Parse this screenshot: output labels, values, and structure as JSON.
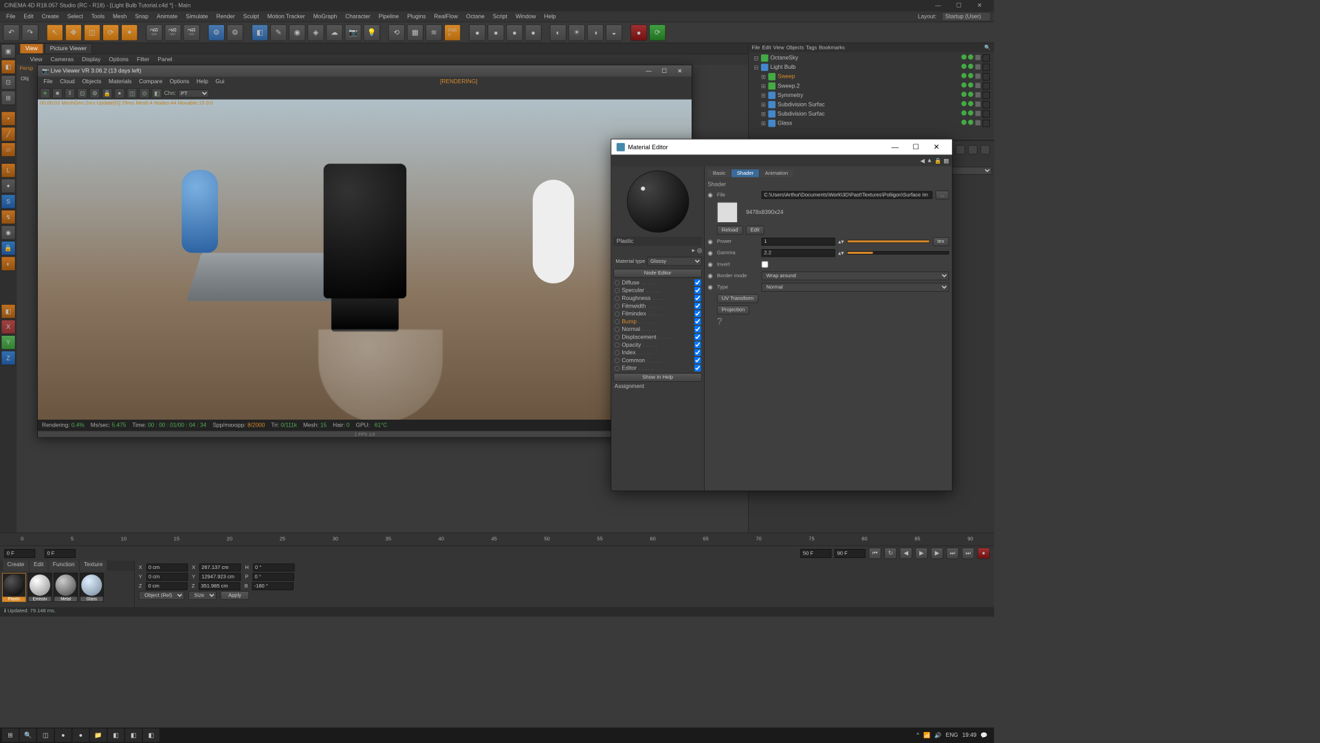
{
  "app": {
    "title": "CINEMA 4D R18.057 Studio (RC - R18) - [Light Bulb Tutorial.c4d *] - Main",
    "layout_label": "Layout:",
    "layout_value": "Startup (User)"
  },
  "main_menu": [
    "File",
    "Edit",
    "Create",
    "Select",
    "Tools",
    "Mesh",
    "Snap",
    "Animate",
    "Simulate",
    "Render",
    "Sculpt",
    "Motion Tracker",
    "MoGraph",
    "Character",
    "Pipeline",
    "Plugins",
    "RealFlow",
    "Octane",
    "Script",
    "Window",
    "Help"
  ],
  "view_tabs": {
    "active": "View",
    "other": "Picture Viewer"
  },
  "sub_menu": [
    "View",
    "Cameras",
    "Display",
    "Options",
    "Filter",
    "Panel"
  ],
  "persp_label": "Persp",
  "obj_label": "Obj",
  "live_viewer": {
    "title": "Live Viewer VR 3.06.2 (13 days left)",
    "menu": [
      "File",
      "Cloud",
      "Objects",
      "Materials",
      "Compare",
      "Options",
      "Help",
      "Gui"
    ],
    "rendering_badge": "[RENDERING]",
    "chn_label": "Chn:",
    "chn_value": "PT",
    "overlay": "00:00:02  MeshGen:2ms  Update[G]:79ms  Mesh:4 Nodes:44 Movable:15  0:0"
  },
  "status": {
    "rendering_label": "Rendering:",
    "rendering_value": "0.4%",
    "ms_label": "Ms/sec:",
    "ms_value": "5.475",
    "time_label": "Time:",
    "time_value": "00 : 00 : 01/00 : 04 : 34",
    "spp_label": "Spp/maxspp:",
    "spp_value": "8/2000",
    "tri_label": "Tri:",
    "tri_value": "0/111k",
    "mesh_label": "Mesh:",
    "mesh_value": "15",
    "hair_label": "Hair:",
    "hair_value": "0",
    "gpu_label": "GPU:",
    "gpu_value": "61°C"
  },
  "fps_label": "1 FPS 1/3",
  "timeline": {
    "ticks": [
      "0",
      "5",
      "10",
      "15",
      "20",
      "25",
      "30",
      "35",
      "40",
      "45",
      "50",
      "55",
      "60",
      "65",
      "70",
      "75",
      "80",
      "85",
      "90"
    ]
  },
  "transport": {
    "cur": "0 F",
    "start": "0 F",
    "endA": "50 F",
    "endB": "90 F"
  },
  "mat_tabs": [
    "Create",
    "Edit",
    "Function",
    "Texture"
  ],
  "materials": [
    {
      "name": "Plastic",
      "variant": "black",
      "selected": true
    },
    {
      "name": "Emissiv",
      "variant": "white",
      "selected": false
    },
    {
      "name": "Metal",
      "variant": "metal",
      "selected": false
    },
    {
      "name": "Glass",
      "variant": "glass",
      "selected": false
    }
  ],
  "coords": {
    "x": "0 cm",
    "sx": "267.137 cm",
    "h": "0 °",
    "y": "0 cm",
    "sy": "12947.923 cm",
    "p": "0 °",
    "z": "0 cm",
    "sz": "351.985 cm",
    "b": "-180 °",
    "mode": "Object (Rel)",
    "sizemode": "Size",
    "apply": "Apply"
  },
  "bottom_status": "Updated: 79.148 ms.",
  "obj_panel": {
    "menu": [
      "File",
      "Edit",
      "View",
      "Objects",
      "Tags",
      "Bookmarks"
    ],
    "items": [
      {
        "name": "OctaneSky",
        "indent": 0,
        "color": "green"
      },
      {
        "name": "Light Bulb",
        "indent": 0,
        "color": "blue"
      },
      {
        "name": "Sweep",
        "indent": 1,
        "color": "green",
        "selected": true
      },
      {
        "name": "Sweep.2",
        "indent": 1,
        "color": "green"
      },
      {
        "name": "Symmetry",
        "indent": 1,
        "color": "blue"
      },
      {
        "name": "Subdivision Surfac",
        "indent": 1,
        "color": "blue"
      },
      {
        "name": "Subdivision Surfac",
        "indent": 1,
        "color": "blue"
      },
      {
        "name": "Glass",
        "indent": 1,
        "color": "blue"
      }
    ]
  },
  "material_editor": {
    "title": "Material Editor",
    "tabs": {
      "a": "Basic",
      "b": "Shader",
      "c": "Animation",
      "active": "Shader"
    },
    "mat_name": "Plastic",
    "type_label": "Material type",
    "type_value": "Glossy",
    "node_editor_btn": "Node Editor",
    "channels": [
      "Diffuse",
      "Specular",
      "Roughness",
      "Filmwidth",
      "Filmindex",
      "Bump",
      "Normal",
      "Displacement",
      "Opacity",
      "Index",
      "Common",
      "Editor"
    ],
    "active_channel": "Bump",
    "show_help": "Show In Help",
    "assignment": "Assignment",
    "shader_label": "Shader",
    "file_label": "File",
    "file_value": "C:\\Users\\Arthur\\Documents\\Work\\3D\\Past\\Textures\\Poliigon\\Surface Im",
    "tex_info": "9478x8390x24",
    "reload": "Reload",
    "edit": "Edit",
    "power_label": "Power",
    "power_value": "1",
    "tex_btn": "tex",
    "gamma_label": "Gamma",
    "gamma_value": "2.2",
    "invert_label": "Invert",
    "border_label": "Border mode",
    "border_value": "Wrap around",
    "typ_label": "Type",
    "typ_value": "Normal",
    "uv_btn": "UV Transform",
    "proj_btn": "Projection"
  },
  "taskbar": {
    "lang": "ENG",
    "time": "19:49"
  }
}
